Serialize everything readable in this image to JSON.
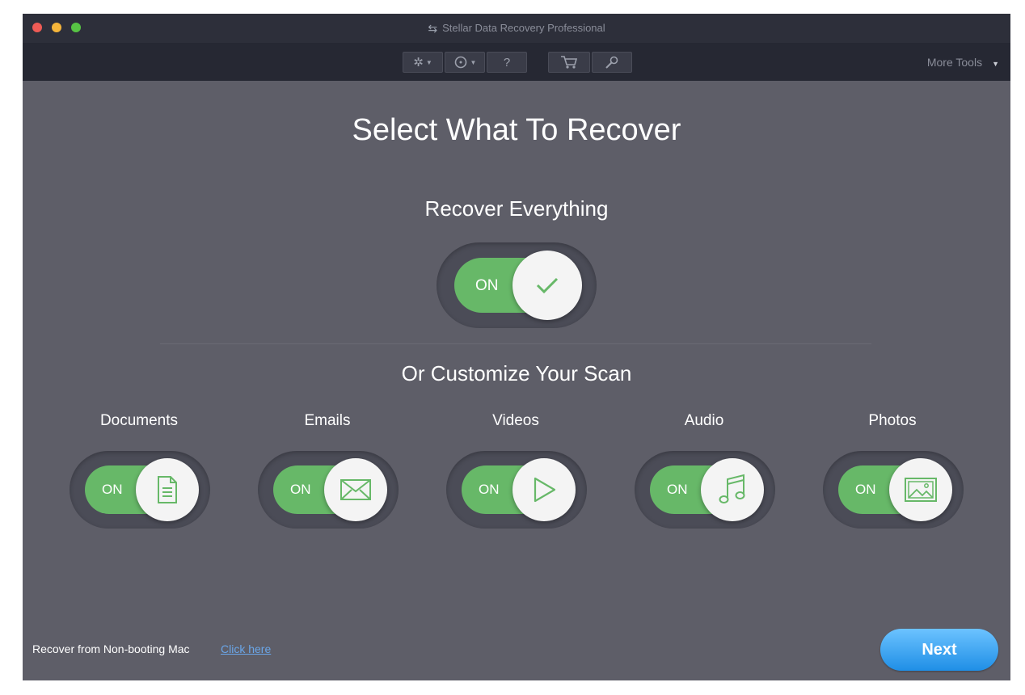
{
  "window": {
    "title": "Stellar Data Recovery Professional",
    "toolbar": {
      "buttons": [
        {
          "icon": "gear-icon",
          "has_dropdown": true
        },
        {
          "icon": "history-icon",
          "has_dropdown": true
        },
        {
          "icon": "help-icon",
          "label": "?"
        },
        {
          "icon": "cart-icon"
        },
        {
          "icon": "wrench-icon"
        }
      ],
      "more_tools": "More Tools"
    }
  },
  "main": {
    "heading": "Select What To Recover",
    "recover_everything": {
      "label": "Recover Everything",
      "state": "ON"
    },
    "customize_heading": "Or Customize Your Scan",
    "categories": [
      {
        "label": "Documents",
        "state": "ON",
        "icon": "document-icon"
      },
      {
        "label": "Emails",
        "state": "ON",
        "icon": "email-icon"
      },
      {
        "label": "Videos",
        "state": "ON",
        "icon": "video-play-icon"
      },
      {
        "label": "Audio",
        "state": "ON",
        "icon": "music-note-icon"
      },
      {
        "label": "Photos",
        "state": "ON",
        "icon": "photo-icon"
      }
    ]
  },
  "footer": {
    "text": "Recover from Non-booting Mac",
    "link": "Click here",
    "next_button": "Next"
  },
  "colors": {
    "background": "#5e5e68",
    "titlebar": "#2d2f3a",
    "toggle_on": "#67b868",
    "next_button": "#3aa5f5",
    "link": "#6aa6e8"
  }
}
